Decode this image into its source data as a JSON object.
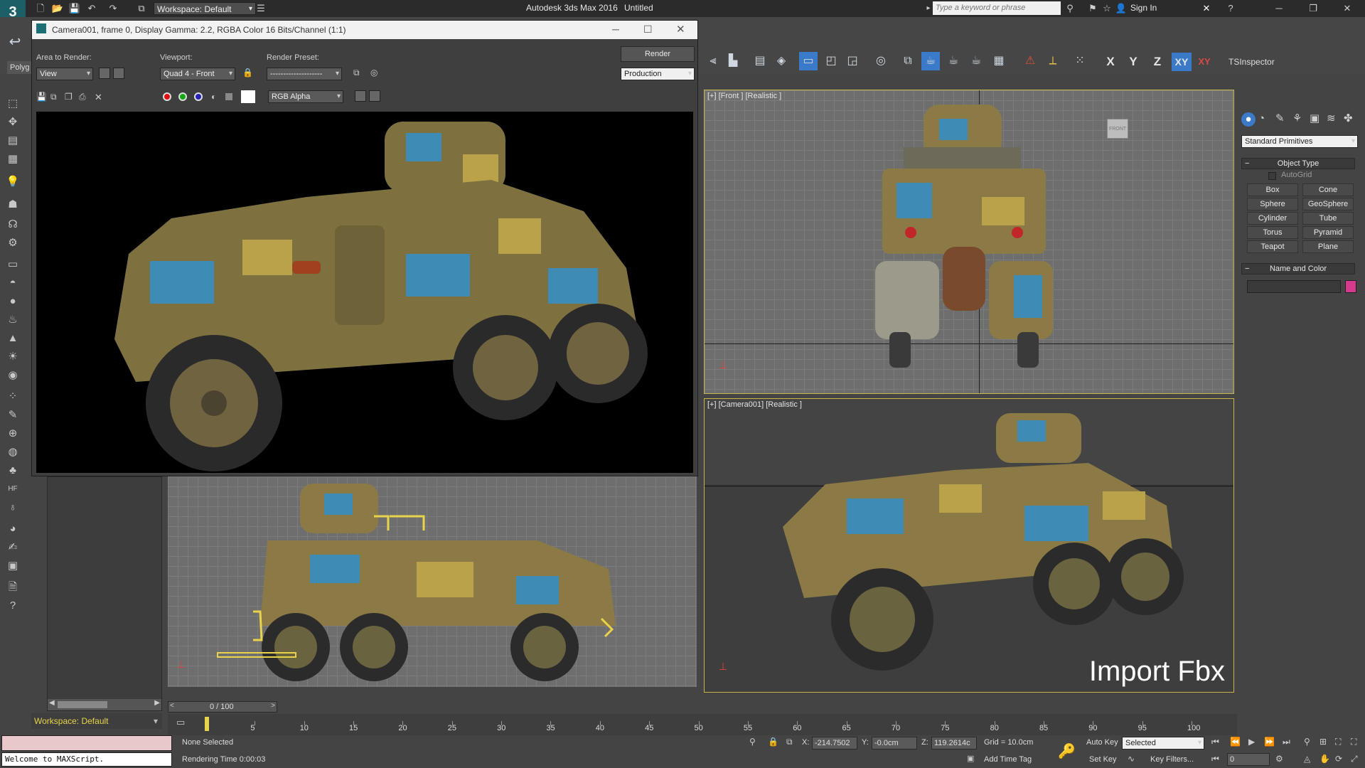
{
  "app": {
    "title": "Autodesk 3ds Max 2016",
    "doc": "Untitled",
    "workspace": "Workspace: Default",
    "search_placeholder": "Type a keyword or phrase",
    "sign_in": "Sign In",
    "ts_inspector": "TSInspector",
    "tab_partial": "Polyg"
  },
  "axis_constraints": [
    "X",
    "Y",
    "Z",
    "XY",
    "XY"
  ],
  "render_frame": {
    "title": "Camera001, frame 0, Display Gamma: 2.2, RGBA Color 16 Bits/Channel (1:1)",
    "area_to_render_label": "Area to Render:",
    "area_to_render_value": "View",
    "viewport_label": "Viewport:",
    "viewport_value": "Quad 4 - Front",
    "render_preset_label": "Render Preset:",
    "render_preset_value": "--------------------",
    "render_button": "Render",
    "production_value": "Production",
    "channel_value": "RGB Alpha"
  },
  "viewports": {
    "front_label": "[+] [Front ] [Realistic ]",
    "camera_label": "[+] [Camera001] [Realistic ]",
    "overlay_text": "Import Fbx"
  },
  "command_panel": {
    "dropdown_value": "Standard Primitives",
    "object_type_header": "Object Type",
    "autogrid_label": "AutoGrid",
    "primitives": [
      "Box",
      "Cone",
      "Sphere",
      "GeoSphere",
      "Cylinder",
      "Tube",
      "Torus",
      "Pyramid",
      "Teapot",
      "Plane"
    ],
    "name_color_header": "Name and Color",
    "object_color": "#d63a8c"
  },
  "left_panel": {
    "workspace_label": "Workspace: Default"
  },
  "timeline": {
    "frame_counter": "0 / 100",
    "ticks": [
      "5",
      "10",
      "15",
      "20",
      "25",
      "30",
      "35",
      "40",
      "45",
      "50",
      "55",
      "60",
      "65",
      "70",
      "75",
      "80",
      "85",
      "90",
      "95",
      "100"
    ]
  },
  "status": {
    "maxscript": "Welcome to MAXScript.",
    "selection": "None Selected",
    "render_time": "Rendering Time  0:00:03",
    "x_label": "X:",
    "x_value": "-214.7502",
    "y_label": "Y:",
    "y_value": "-0.0cm",
    "z_label": "Z:",
    "z_value": "119.2614c",
    "grid": "Grid = 10.0cm",
    "add_time_tag": "Add Time Tag",
    "auto_key": "Auto Key",
    "selected_value": "Selected",
    "set_key": "Set Key",
    "key_filters": "Key Filters...",
    "frame_value": "0"
  },
  "colors": {
    "accent": "#3b7ac9",
    "camo_tan": "#8b7a45",
    "camo_blue": "#3e8bb5",
    "camo_yellow": "#b9a24a",
    "rust": "#7a4a2c",
    "selection_yellow": "#e8d34a"
  }
}
